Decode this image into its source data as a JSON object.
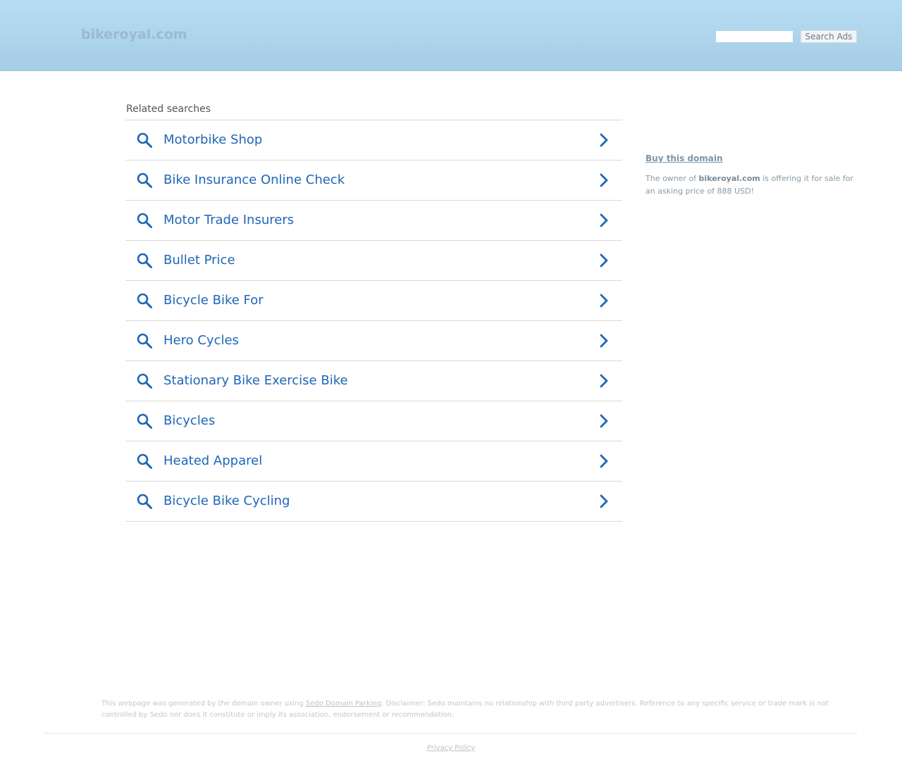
{
  "header": {
    "logo": "bikeroyal.com",
    "search_value": "",
    "search_button": "Search Ads"
  },
  "related": {
    "title": "Related searches",
    "items": [
      {
        "label": "Motorbike Shop"
      },
      {
        "label": "Bike Insurance Online Check"
      },
      {
        "label": "Motor Trade Insurers"
      },
      {
        "label": "Bullet Price"
      },
      {
        "label": "Bicycle Bike For"
      },
      {
        "label": "Hero Cycles"
      },
      {
        "label": "Stationary Bike Exercise Bike"
      },
      {
        "label": "Bicycles"
      },
      {
        "label": "Heated Apparel"
      },
      {
        "label": "Bicycle Bike Cycling"
      }
    ],
    "item_icon": "search-icon",
    "item_chevron": "chevron-right-icon",
    "link_color": "#1f66b8"
  },
  "sidebar": {
    "buy_title": "Buy this domain",
    "text_before": "The owner of ",
    "domain": "bikeroyal.com",
    "text_after": " is offering it for sale for an asking price of 888 USD!"
  },
  "footer": {
    "disclaimer_before": "This webpage was generated by the domain owner using ",
    "disclaimer_link": "Sedo Domain Parking",
    "disclaimer_after": ". Disclaimer: Sedo maintains no relationship with third party advertisers. Reference to any specific service or trade mark is not controlled by Sedo nor does it constitute or imply its association, endorsement or recommendation.",
    "privacy": "Privacy Policy"
  }
}
